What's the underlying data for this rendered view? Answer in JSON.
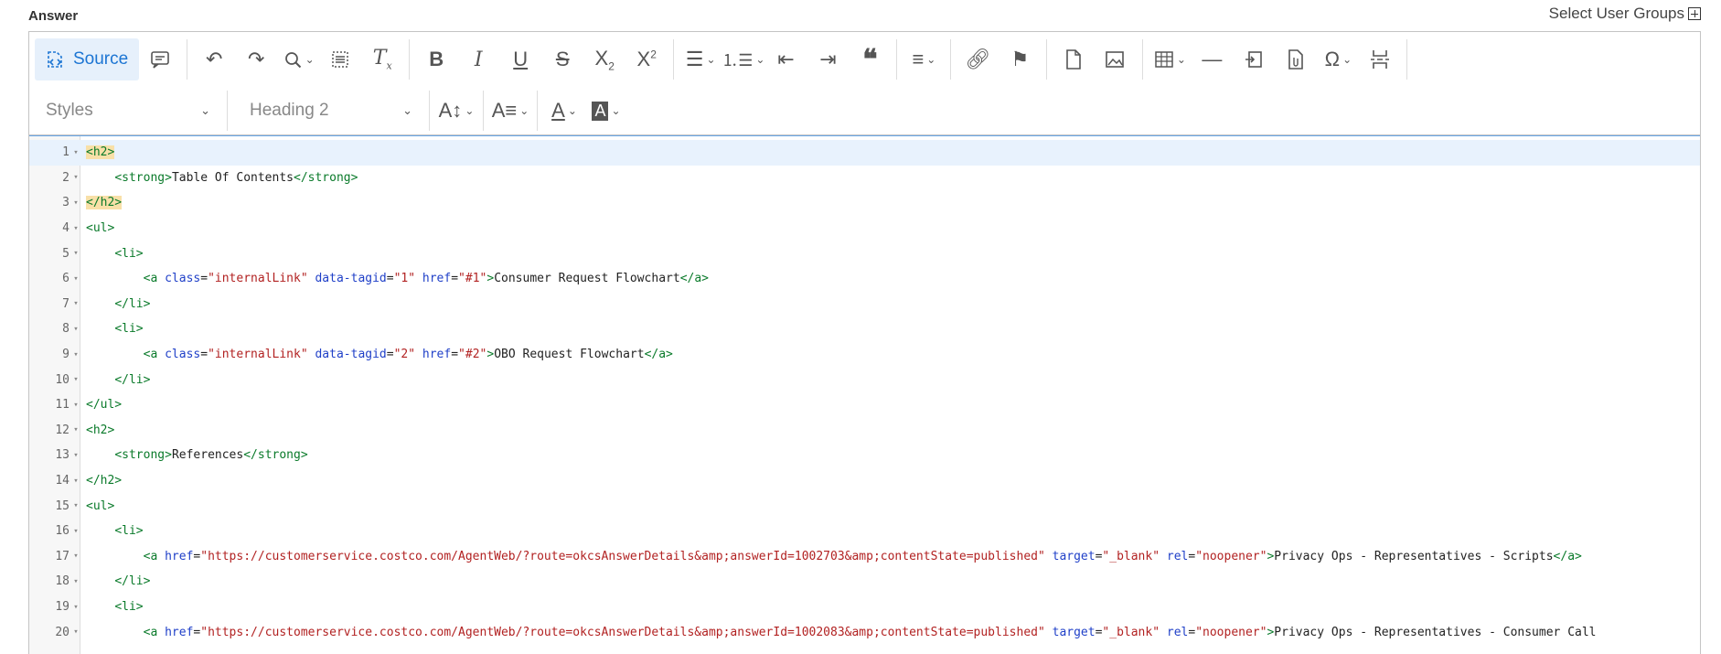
{
  "header": {
    "label": "Answer",
    "user_groups": "Select User Groups"
  },
  "toolbar": {
    "source_label": "Source",
    "styles_select": "Styles",
    "format_select": "Heading 2"
  },
  "code_lines": [
    {
      "n": "1",
      "html": "<span class=\"tag hl\">&lt;h2&gt;</span>"
    },
    {
      "n": "2",
      "html": "    <span class=\"tag\">&lt;strong&gt;</span>Table Of Contents<span class=\"tag\">&lt;/strong&gt;</span>"
    },
    {
      "n": "3",
      "html": "<span class=\"tag hl\">&lt;/h2&gt;</span>"
    },
    {
      "n": "4",
      "html": "<span class=\"tag\">&lt;ul&gt;</span>"
    },
    {
      "n": "5",
      "html": "    <span class=\"tag\">&lt;li&gt;</span>"
    },
    {
      "n": "6",
      "html": "        <span class=\"tag\">&lt;a</span> <span class=\"attr\">class</span>=<span class=\"val\">\"internalLink\"</span> <span class=\"attr\">data-tagid</span>=<span class=\"val\">\"1\"</span> <span class=\"attr\">href</span>=<span class=\"val\">\"#1\"</span><span class=\"tag\">&gt;</span>Consumer Request Flowchart<span class=\"tag\">&lt;/a&gt;</span>"
    },
    {
      "n": "7",
      "html": "    <span class=\"tag\">&lt;/li&gt;</span>"
    },
    {
      "n": "8",
      "html": "    <span class=\"tag\">&lt;li&gt;</span>"
    },
    {
      "n": "9",
      "html": "        <span class=\"tag\">&lt;a</span> <span class=\"attr\">class</span>=<span class=\"val\">\"internalLink\"</span> <span class=\"attr\">data-tagid</span>=<span class=\"val\">\"2\"</span> <span class=\"attr\">href</span>=<span class=\"val\">\"#2\"</span><span class=\"tag\">&gt;</span>OBO Request Flowchart<span class=\"tag\">&lt;/a&gt;</span>"
    },
    {
      "n": "10",
      "html": "    <span class=\"tag\">&lt;/li&gt;</span>"
    },
    {
      "n": "11",
      "html": "<span class=\"tag\">&lt;/ul&gt;</span>"
    },
    {
      "n": "12",
      "html": "<span class=\"tag\">&lt;h2&gt;</span>"
    },
    {
      "n": "13",
      "html": "    <span class=\"tag\">&lt;strong&gt;</span>References<span class=\"tag\">&lt;/strong&gt;</span>"
    },
    {
      "n": "14",
      "html": "<span class=\"tag\">&lt;/h2&gt;</span>"
    },
    {
      "n": "15",
      "html": "<span class=\"tag\">&lt;ul&gt;</span>"
    },
    {
      "n": "16",
      "html": "    <span class=\"tag\">&lt;li&gt;</span>"
    },
    {
      "n": "17",
      "html": "        <span class=\"tag\">&lt;a</span> <span class=\"attr\">href</span>=<span class=\"val\">\"https://customerservice.costco.com/AgentWeb/?route=okcsAnswerDetails&amp;amp;answerId=1002703&amp;amp;contentState=published\"</span> <span class=\"attr\">target</span>=<span class=\"val\">\"_blank\"</span> <span class=\"attr\">rel</span>=<span class=\"val\">\"noopener\"</span><span class=\"tag\">&gt;</span>Privacy Ops - Representatives - Scripts<span class=\"tag\">&lt;/a&gt;</span>"
    },
    {
      "n": "18",
      "html": "    <span class=\"tag\">&lt;/li&gt;</span>"
    },
    {
      "n": "19",
      "html": "    <span class=\"tag\">&lt;li&gt;</span>"
    },
    {
      "n": "20",
      "html": "        <span class=\"tag\">&lt;a</span> <span class=\"attr\">href</span>=<span class=\"val\">\"https://customerservice.costco.com/AgentWeb/?route=okcsAnswerDetails&amp;amp;answerId=1002083&amp;amp;contentState=published\"</span> <span class=\"attr\">target</span>=<span class=\"val\">\"_blank\"</span> <span class=\"attr\">rel</span>=<span class=\"val\">\"noopener\"</span><span class=\"tag\">&gt;</span>Privacy Ops - Representatives - Consumer Call"
    }
  ]
}
